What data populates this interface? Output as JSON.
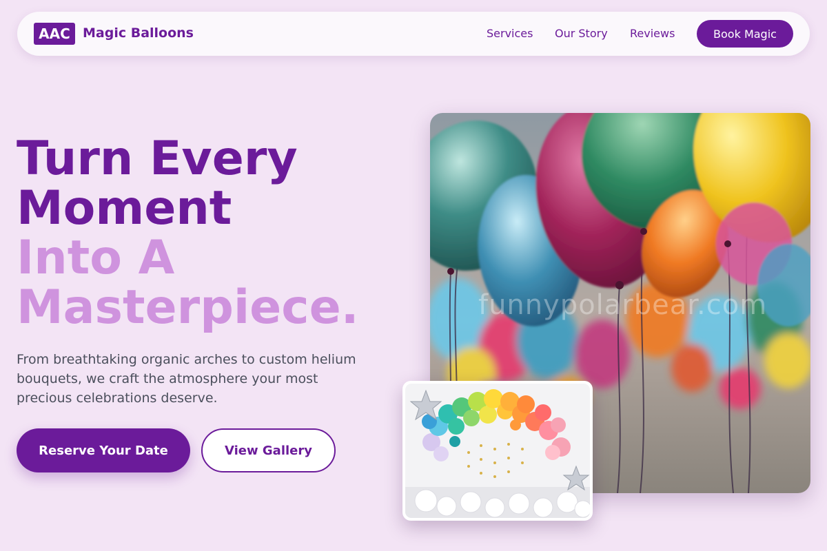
{
  "nav": {
    "logo_text": "AAC",
    "brand": "Magic Balloons",
    "links": [
      "Services",
      "Our Story",
      "Reviews"
    ],
    "cta": "Book Magic"
  },
  "hero": {
    "headline_line1": "Turn Every",
    "headline_line2": "Moment",
    "headline_line3": "Into A",
    "headline_line4": "Masterpiece.",
    "description": "From breathtaking organic arches to custom helium bouquets, we craft the atmosphere your most precious celebrations deserve.",
    "primary_button": "Reserve Your Date",
    "secondary_button": "View Gallery"
  },
  "images": {
    "main_alt": "Colorful metallic helium balloons",
    "main_watermark": "funnypolarbear.com",
    "inset_alt": "Rainbow organic balloon arch"
  },
  "colors": {
    "brand": "#6b1b9a",
    "accent": "#cf93de",
    "background": "#f3e4f5"
  }
}
